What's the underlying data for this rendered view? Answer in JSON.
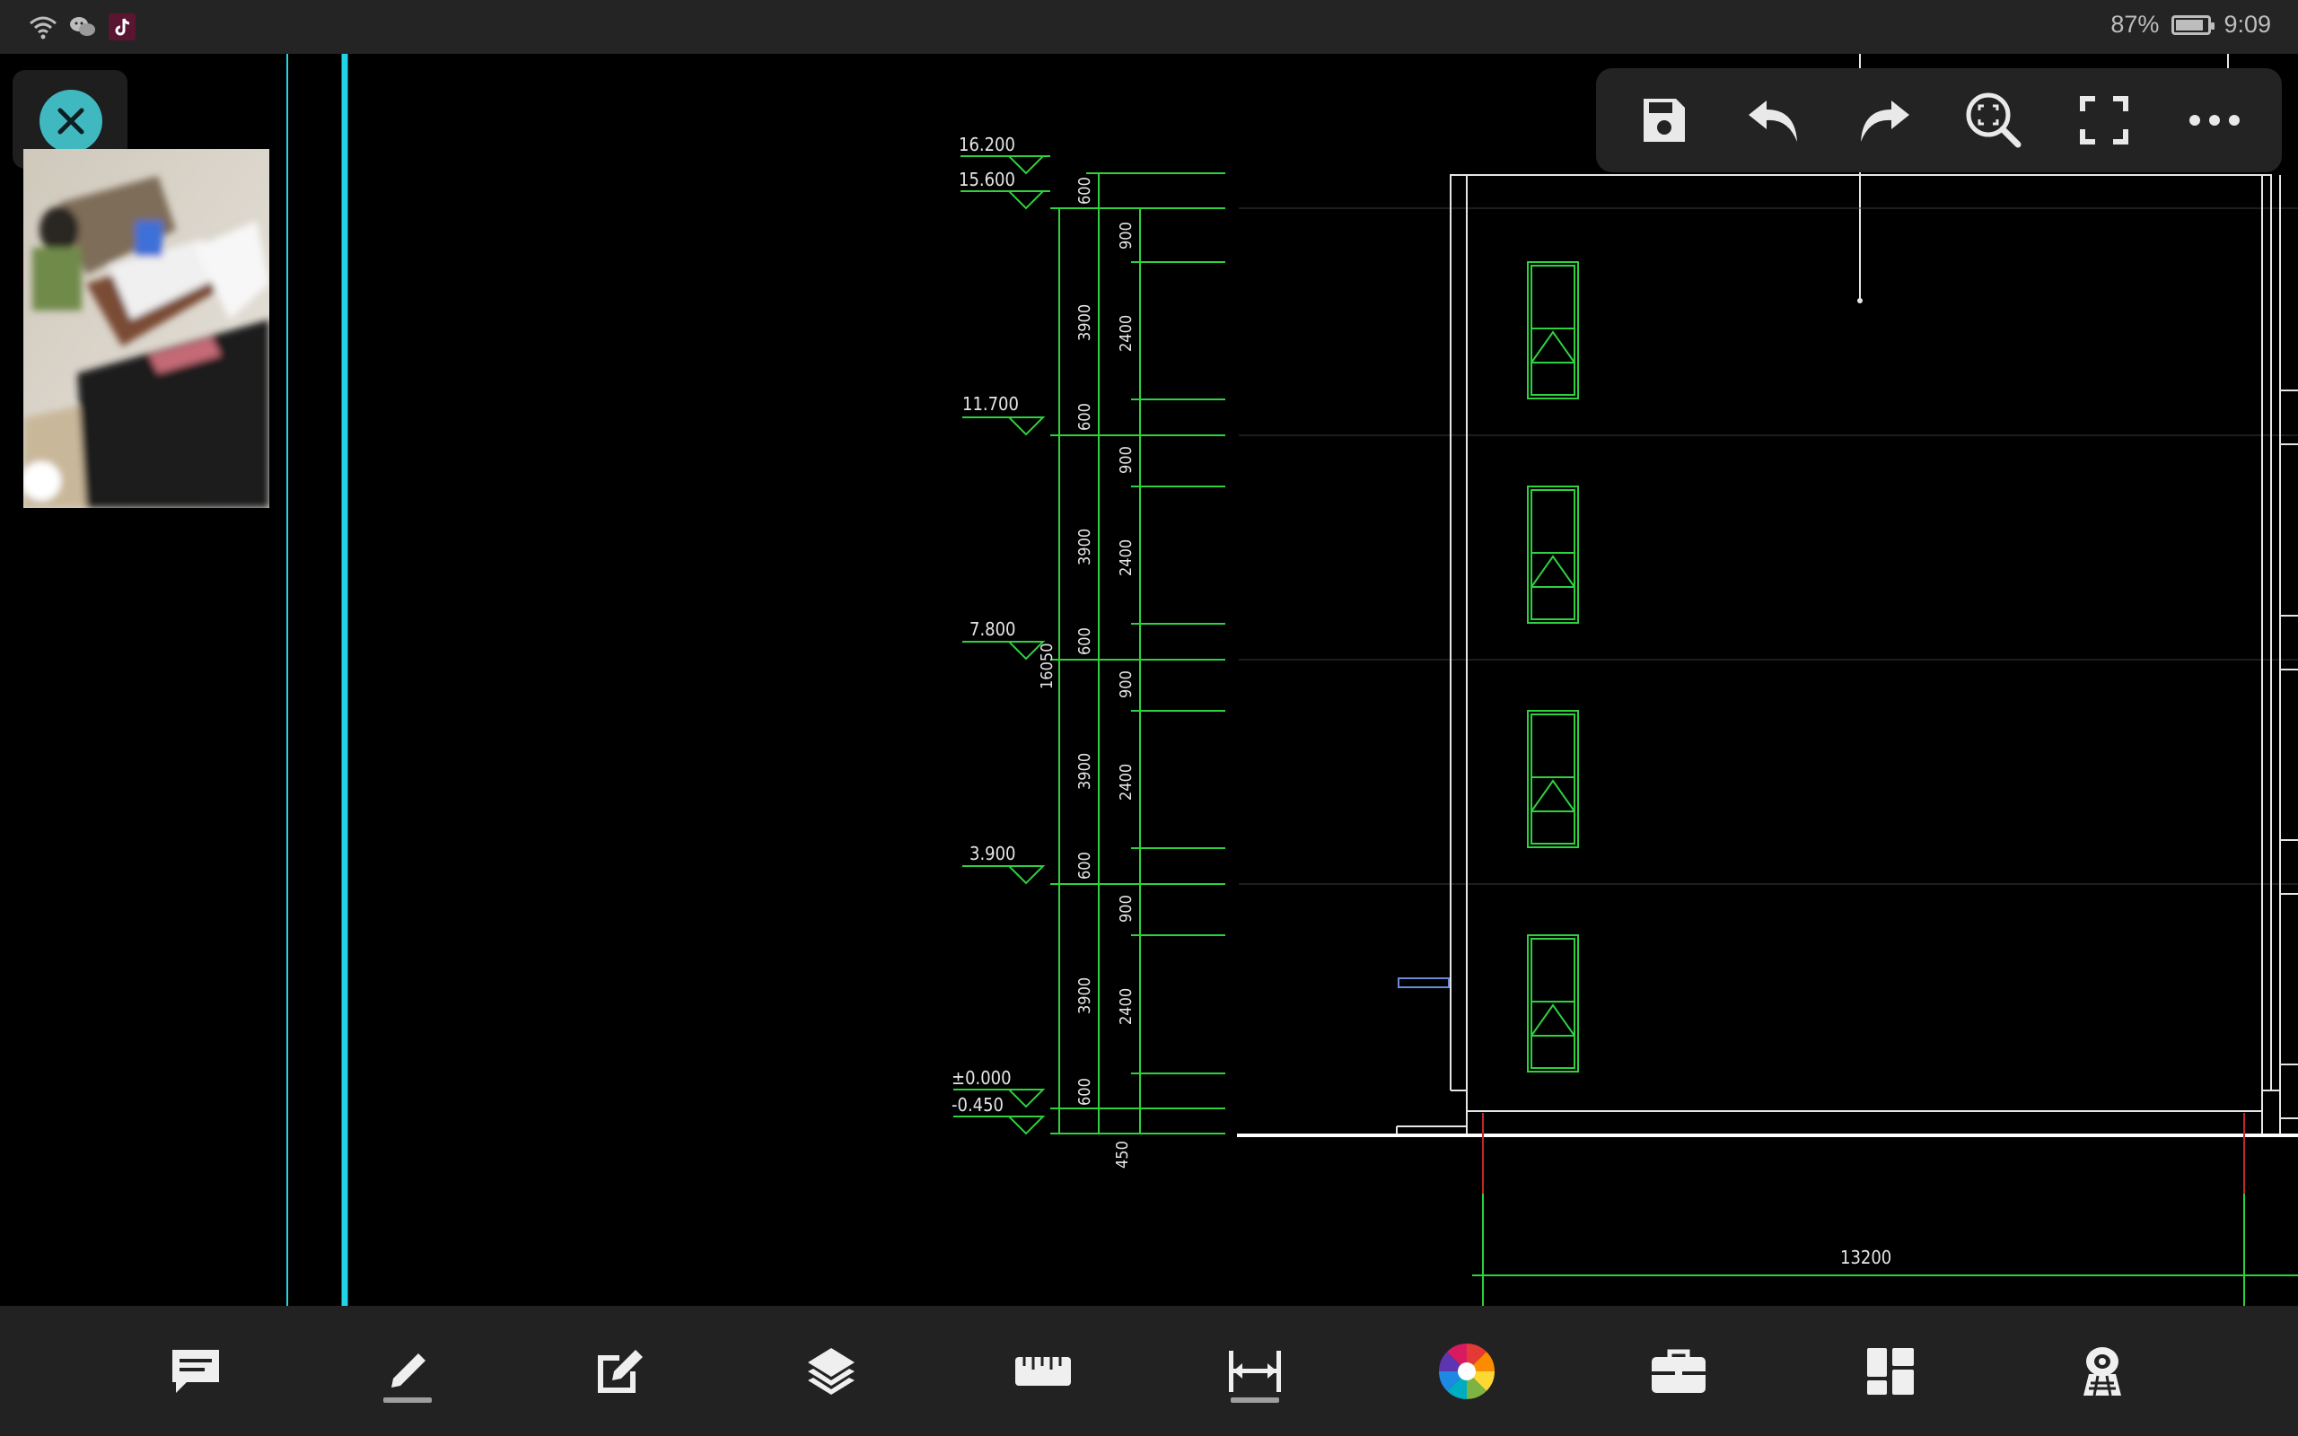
{
  "status_bar": {
    "battery_percent": "87%",
    "time": "9:09",
    "battery_level": 0.87,
    "icons": [
      "wifi-icon",
      "wechat-icon",
      "tiktok-icon"
    ]
  },
  "top_toolbar": {
    "buttons": [
      {
        "name": "save",
        "icon": "save-icon"
      },
      {
        "name": "undo",
        "icon": "undo-icon"
      },
      {
        "name": "redo",
        "icon": "redo-icon"
      },
      {
        "name": "zoom-extents",
        "icon": "zoom-fit-icon"
      },
      {
        "name": "fullscreen",
        "icon": "fullscreen-icon"
      },
      {
        "name": "more",
        "icon": "more-icon"
      }
    ]
  },
  "bottom_toolbar": {
    "buttons": [
      {
        "name": "comment",
        "icon": "comment-icon"
      },
      {
        "name": "pen",
        "icon": "pen-icon"
      },
      {
        "name": "edit",
        "icon": "edit-icon"
      },
      {
        "name": "layers",
        "icon": "layers-icon"
      },
      {
        "name": "ruler",
        "icon": "ruler-icon"
      },
      {
        "name": "dimension",
        "icon": "dimension-icon"
      },
      {
        "name": "color",
        "icon": "color-wheel-icon"
      },
      {
        "name": "toolbox",
        "icon": "toolbox-icon"
      },
      {
        "name": "layout",
        "icon": "layout-grid-icon"
      },
      {
        "name": "3d-view",
        "icon": "3d-view-icon"
      }
    ]
  },
  "drawing": {
    "elevations": [
      "16.200",
      "15.600",
      "11.700",
      "7.800",
      "3.900",
      "±0.000",
      "-0.450"
    ],
    "outer_dim": "16050",
    "floor_dims": [
      "3900",
      "3900",
      "3900",
      "3900"
    ],
    "detail_dims": {
      "top_parapet": "600",
      "floors": [
        {
          "a": "900",
          "b": "2400",
          "c": "600"
        },
        {
          "a": "900",
          "b": "2400",
          "c": "600"
        },
        {
          "a": "900",
          "b": "2400",
          "c": "600"
        },
        {
          "a": "900",
          "b": "2400",
          "c": "600"
        }
      ],
      "base": "450"
    },
    "width_dim": "13200"
  },
  "colors": {
    "cad_green": "#2ed13e",
    "cad_cyan": "#22d3e6",
    "cad_white": "#e6e6e6",
    "accent_teal": "#3fb8c0",
    "dim_red": "#c0282e"
  }
}
